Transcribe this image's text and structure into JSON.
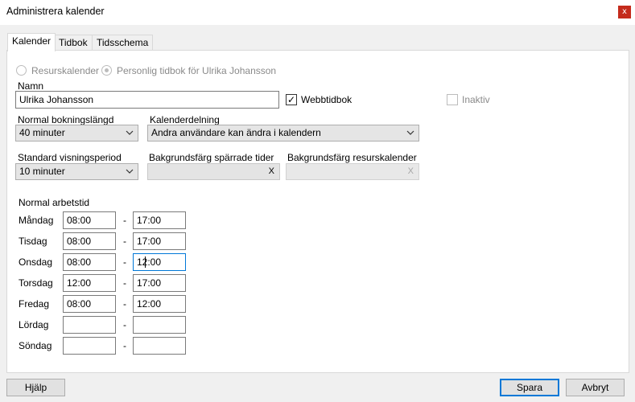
{
  "window": {
    "title": "Administrera kalender",
    "close_glyph": "x"
  },
  "tabs": [
    {
      "label": "Kalender",
      "active": true
    },
    {
      "label": "Tidbok",
      "active": false
    },
    {
      "label": "Tidsschema",
      "active": false
    }
  ],
  "calendar_type": {
    "resource_label": "Resurskalender",
    "personal_label": "Personlig tidbok för Ulrika Johansson",
    "selected": "personal"
  },
  "name": {
    "label": "Namn",
    "value": "Ulrika Johansson"
  },
  "webbtidbok": {
    "label": "Webbtidbok",
    "checked": true,
    "check_glyph": "✓"
  },
  "inaktiv": {
    "label": "Inaktiv",
    "checked": false
  },
  "booking_length": {
    "label": "Normal bokningslängd",
    "value": "40 minuter"
  },
  "sharing": {
    "label": "Kalenderdelning",
    "value": "Andra användare kan ändra i kalendern"
  },
  "view_period": {
    "label": "Standard visningsperiod",
    "value": "10 minuter"
  },
  "blocked_color": {
    "label": "Bakgrundsfärg spärrade tider",
    "clear_glyph": "X"
  },
  "resource_color": {
    "label": "Bakgrundsfärg resurskalender",
    "clear_glyph": "X"
  },
  "working_hours": {
    "label": "Normal arbetstid",
    "separator": "-",
    "days": [
      {
        "day": "Måndag",
        "start": "08:00",
        "end": "17:00"
      },
      {
        "day": "Tisdag",
        "start": "08:00",
        "end": "17:00"
      },
      {
        "day": "Onsdag",
        "start": "08:00",
        "end": "12:00"
      },
      {
        "day": "Torsdag",
        "start": "12:00",
        "end": "17:00"
      },
      {
        "day": "Fredag",
        "start": "08:00",
        "end": "12:00"
      },
      {
        "day": "Lördag",
        "start": "",
        "end": ""
      },
      {
        "day": "Söndag",
        "start": "",
        "end": ""
      }
    ]
  },
  "footer": {
    "help_label": "Hjälp",
    "save_label": "Spara",
    "cancel_label": "Avbryt"
  },
  "colors": {
    "accent": "#0078d7",
    "close": "#c42b1c"
  }
}
